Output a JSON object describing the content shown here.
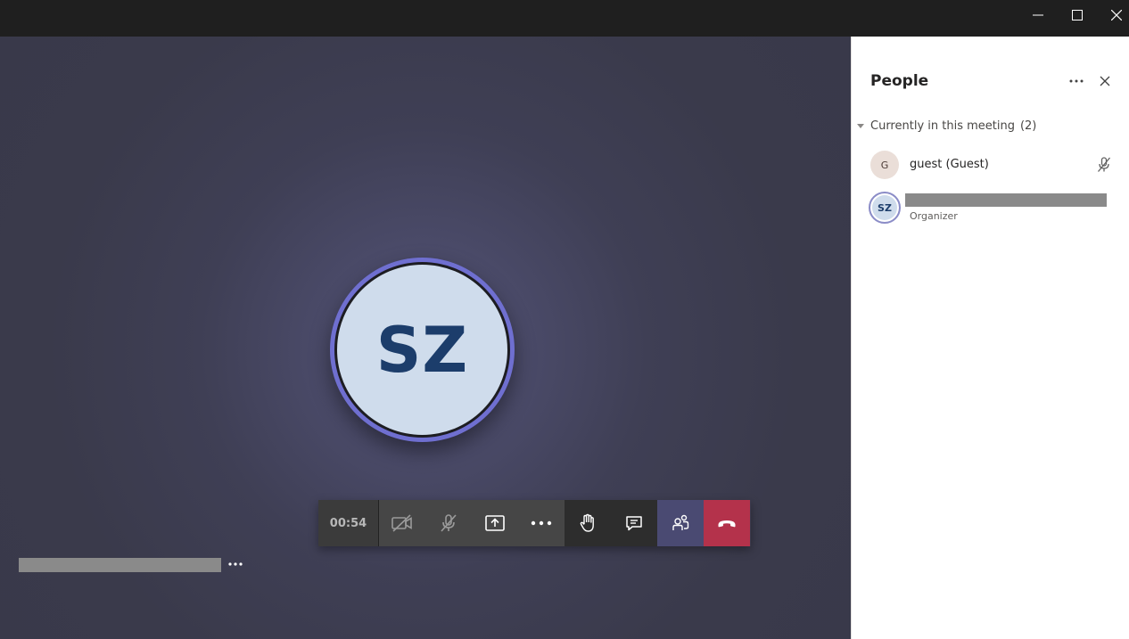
{
  "window": {
    "controls": [
      {
        "name": "minimize-icon"
      },
      {
        "name": "maximize-icon"
      },
      {
        "name": "close-icon"
      }
    ]
  },
  "stage": {
    "avatar_initials": "SZ",
    "ring_color": "#6f6fd0",
    "avatar_bg": "#cfdcec",
    "avatar_text_color": "#1c3d6b"
  },
  "controls": {
    "timer": "00:54",
    "buttons": [
      {
        "icon": "video-off-icon"
      },
      {
        "icon": "mic-off-icon"
      },
      {
        "icon": "share-screen-icon"
      },
      {
        "icon": "more-actions-icon"
      },
      {
        "icon": "raise-hand-icon"
      },
      {
        "icon": "chat-icon"
      },
      {
        "icon": "people-icon",
        "active": true
      },
      {
        "icon": "hang-up-icon",
        "color": "#b4324b"
      }
    ]
  },
  "panel": {
    "title": "People",
    "section_label": "Currently in this meeting",
    "section_count": "(2)",
    "participants": [
      {
        "initials": "G",
        "name": "guest (Guest)",
        "muted": true
      },
      {
        "initials": "SZ",
        "role": "Organizer"
      }
    ]
  }
}
